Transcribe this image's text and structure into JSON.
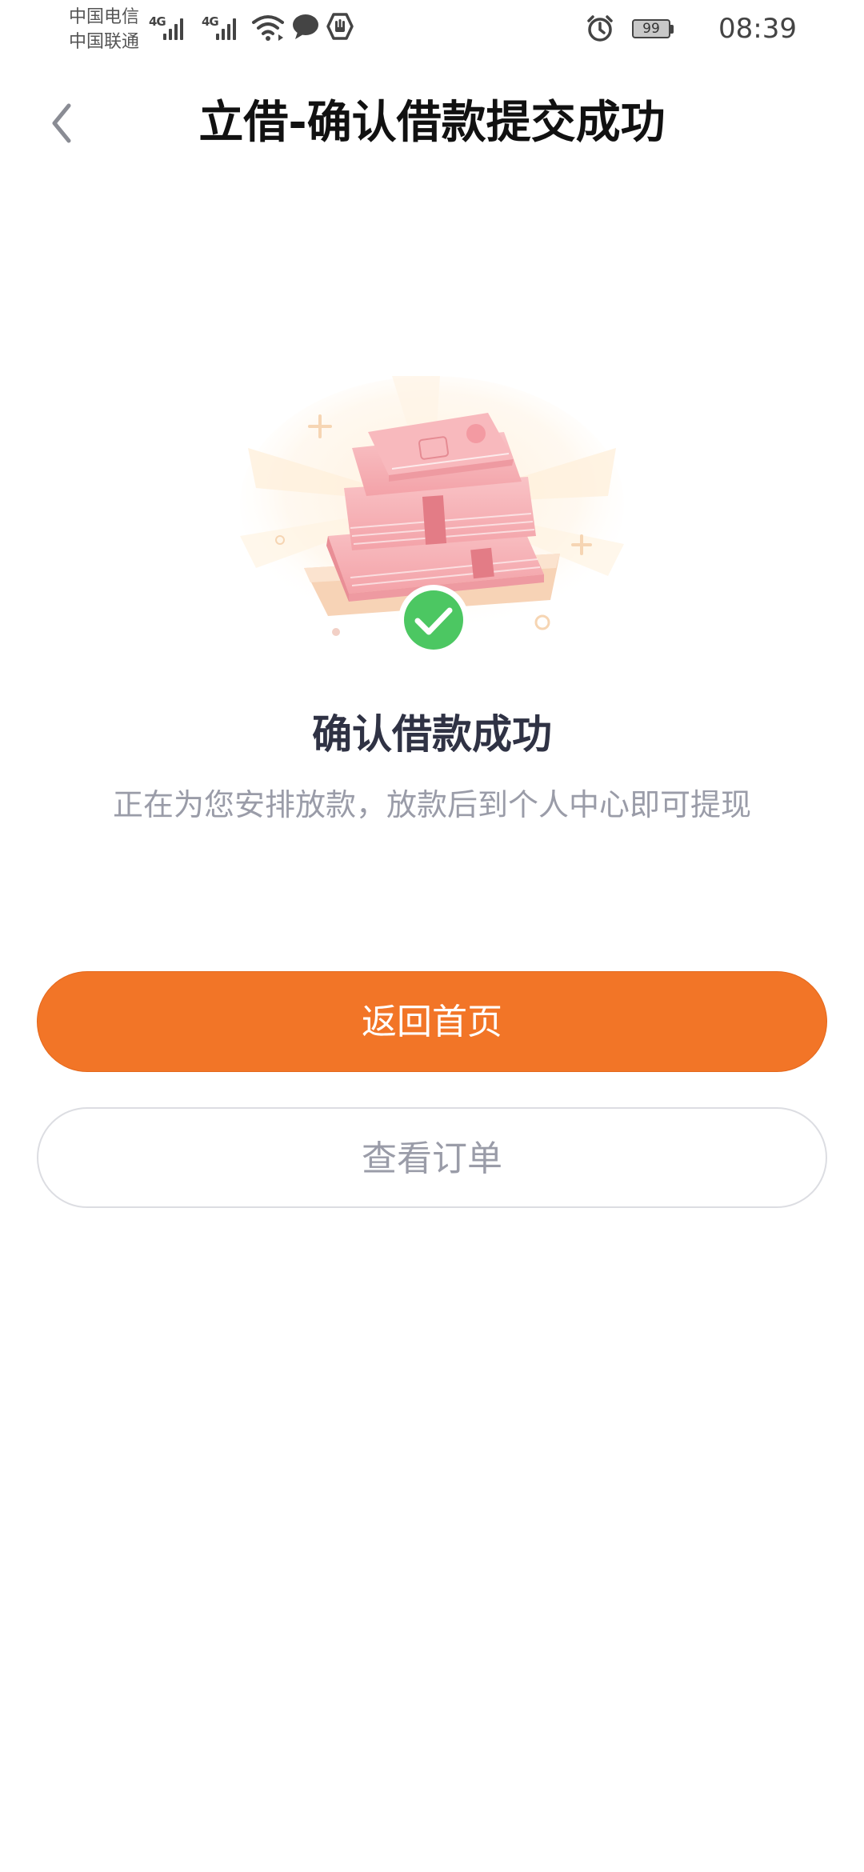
{
  "status_bar": {
    "carrier_1": "中国电信",
    "carrier_2": "中国联通",
    "network_1": "4G",
    "network_2": "4G",
    "icons": [
      "signal-icon",
      "signal-icon",
      "wifi-icon",
      "message-icon",
      "hand-icon",
      "alarm-icon",
      "battery-icon"
    ],
    "battery_level": "99",
    "time": "08:39"
  },
  "nav": {
    "back_icon": "chevron-left-icon",
    "title": "立借-确认借款提交成功"
  },
  "result": {
    "illustration": "money-stack-illustration",
    "check_icon": "check-circle-icon",
    "title": "确认借款成功",
    "description": "正在为您安排放款，放款后到个人中心即可提现"
  },
  "actions": {
    "primary_label": "返回首页",
    "secondary_label": "查看订单"
  },
  "colors": {
    "accent": "#f27527",
    "success": "#4cc762",
    "title_text": "#2f3244",
    "secondary_text": "#9a9ca8"
  }
}
